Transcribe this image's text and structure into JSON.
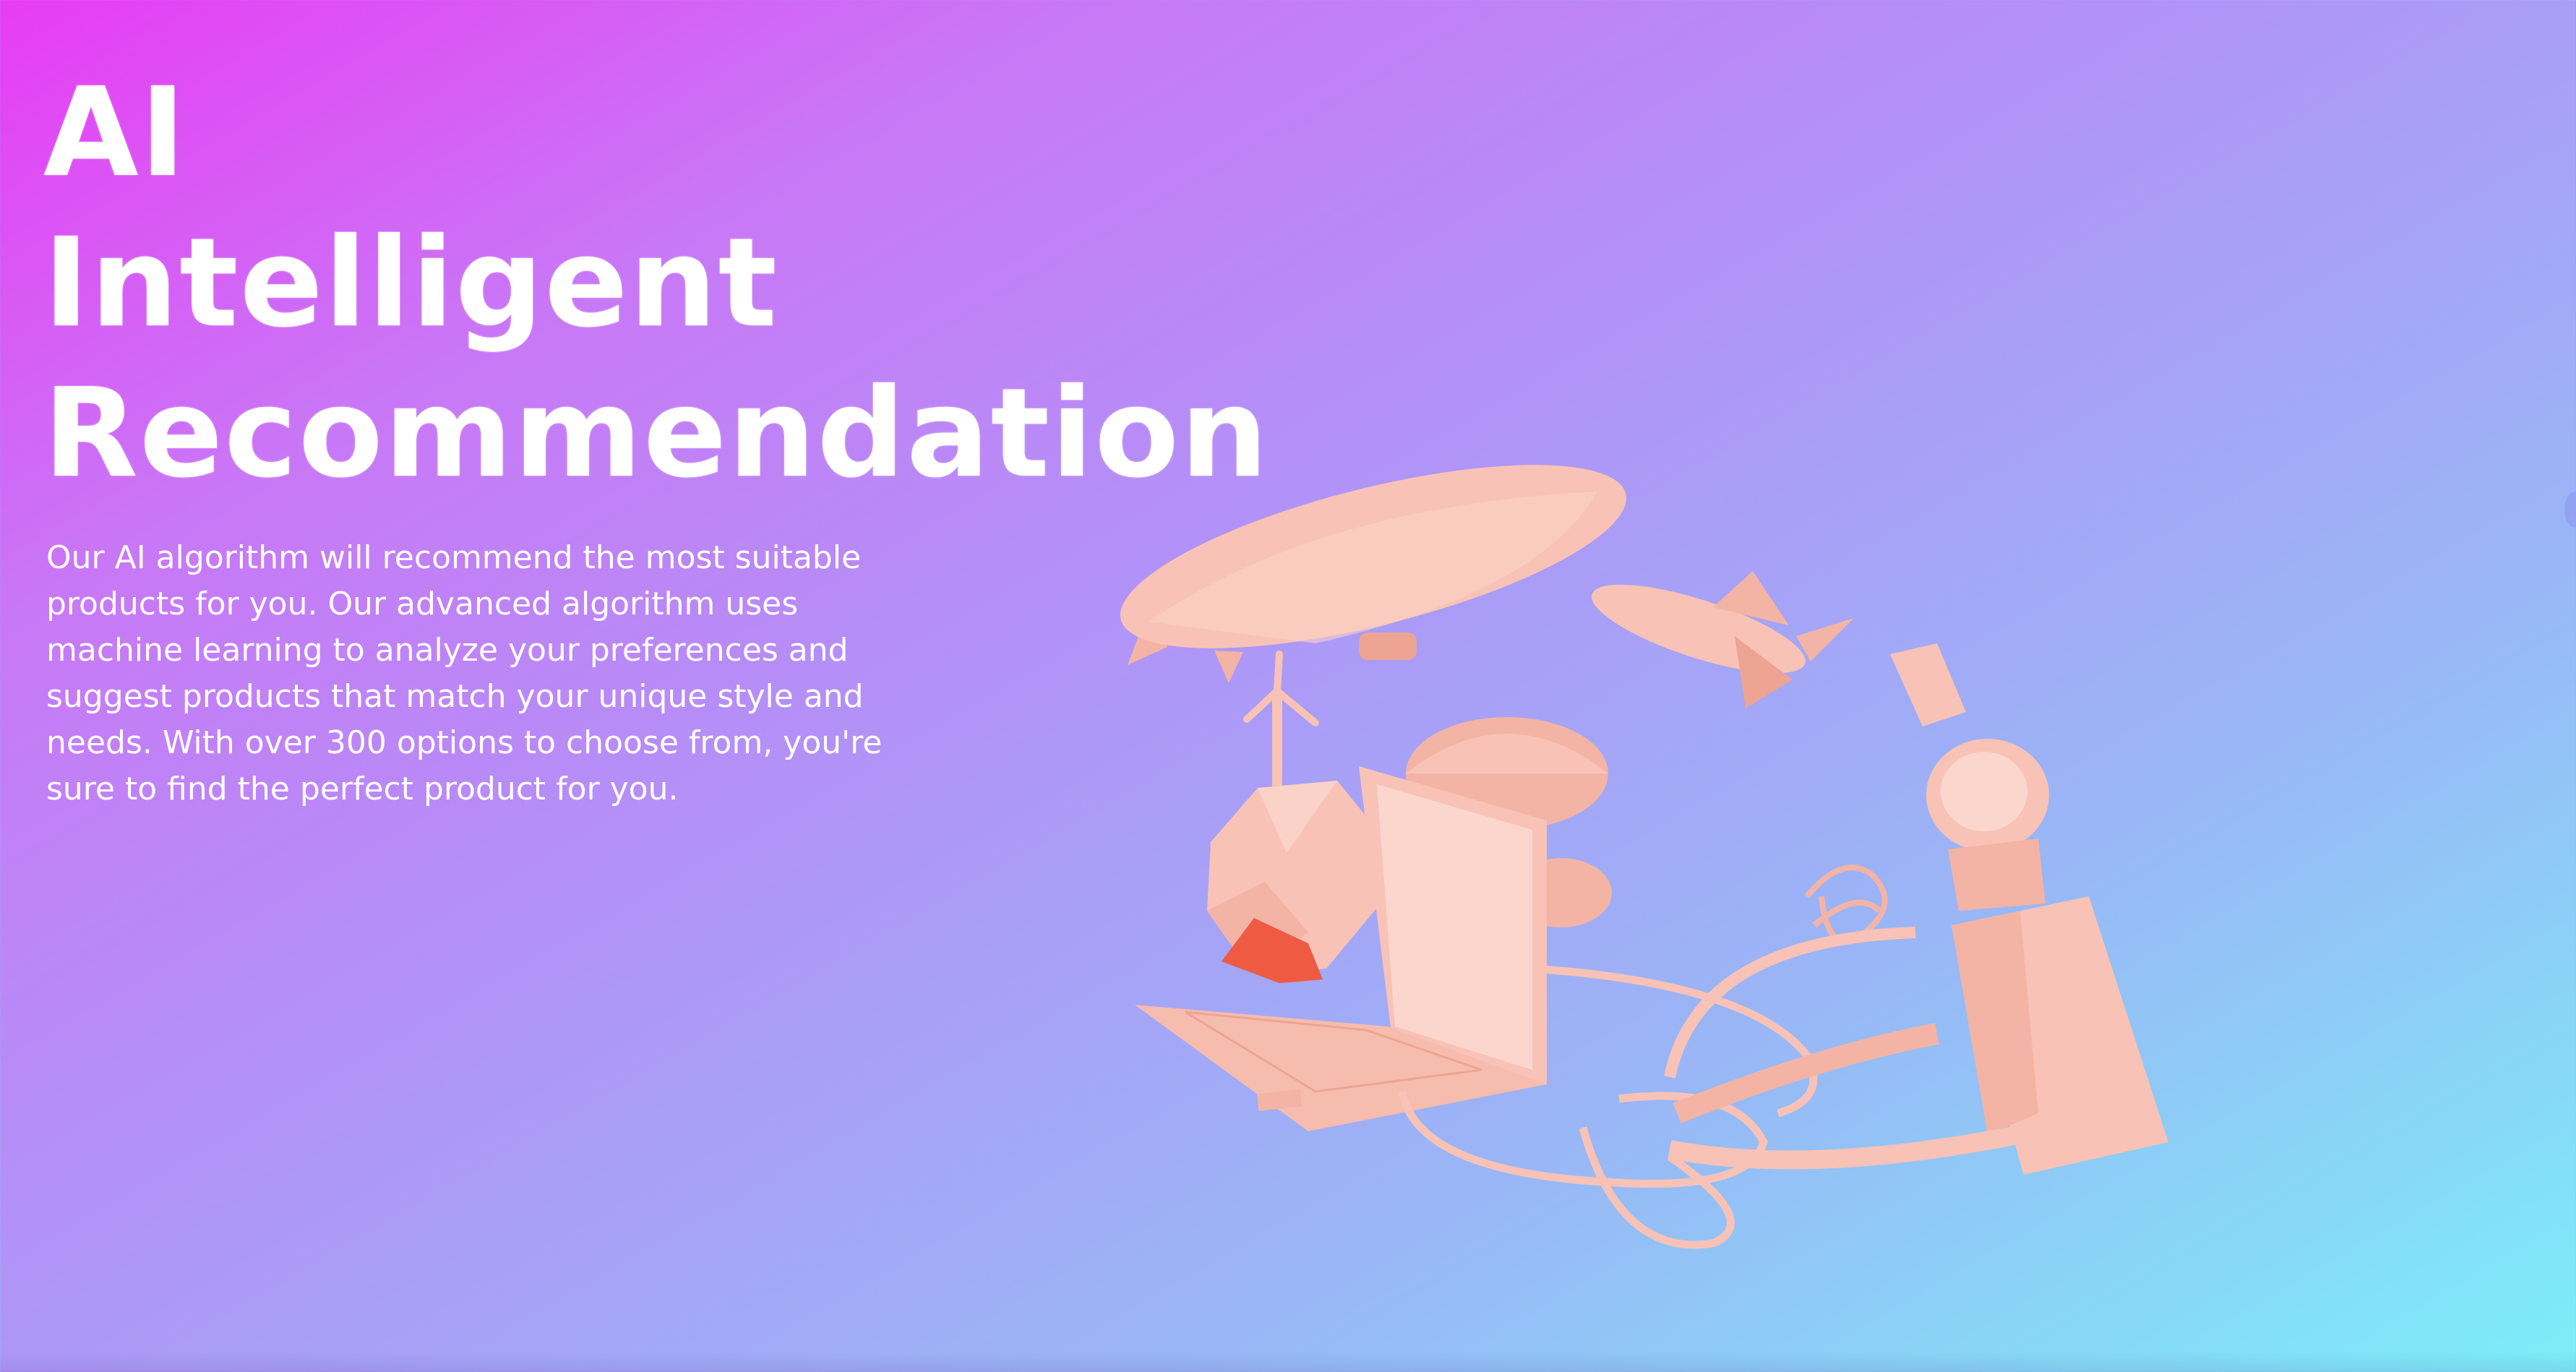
{
  "hero": {
    "title_lines": [
      "AI",
      "Intelligent",
      "Recommendation"
    ],
    "description": "Our AI algorithm will recommend the most suitable products for you. Our advanced algorithm uses machine learning to analyze your preferences and suggest products that match your unique style and needs. With over 300 options to choose from, you're sure to find the perfect product for you."
  },
  "illustration": {
    "items": [
      "airship-icon",
      "rocket-icon",
      "wind-turbine-icon",
      "low-poly-globe-icon",
      "laptop-icon",
      "satellite-dish-icon",
      "dna-helix-icon",
      "smartwatch-icon",
      "vr-headset-icon"
    ]
  },
  "colors": {
    "gradient_start": "#e83cf4",
    "gradient_mid": "#ad98f7",
    "gradient_end": "#7ceef8",
    "object_fill": "#f8c3b6",
    "object_shade": "#eda493",
    "accent_red": "#ef5a42",
    "text": "#ffffff"
  }
}
